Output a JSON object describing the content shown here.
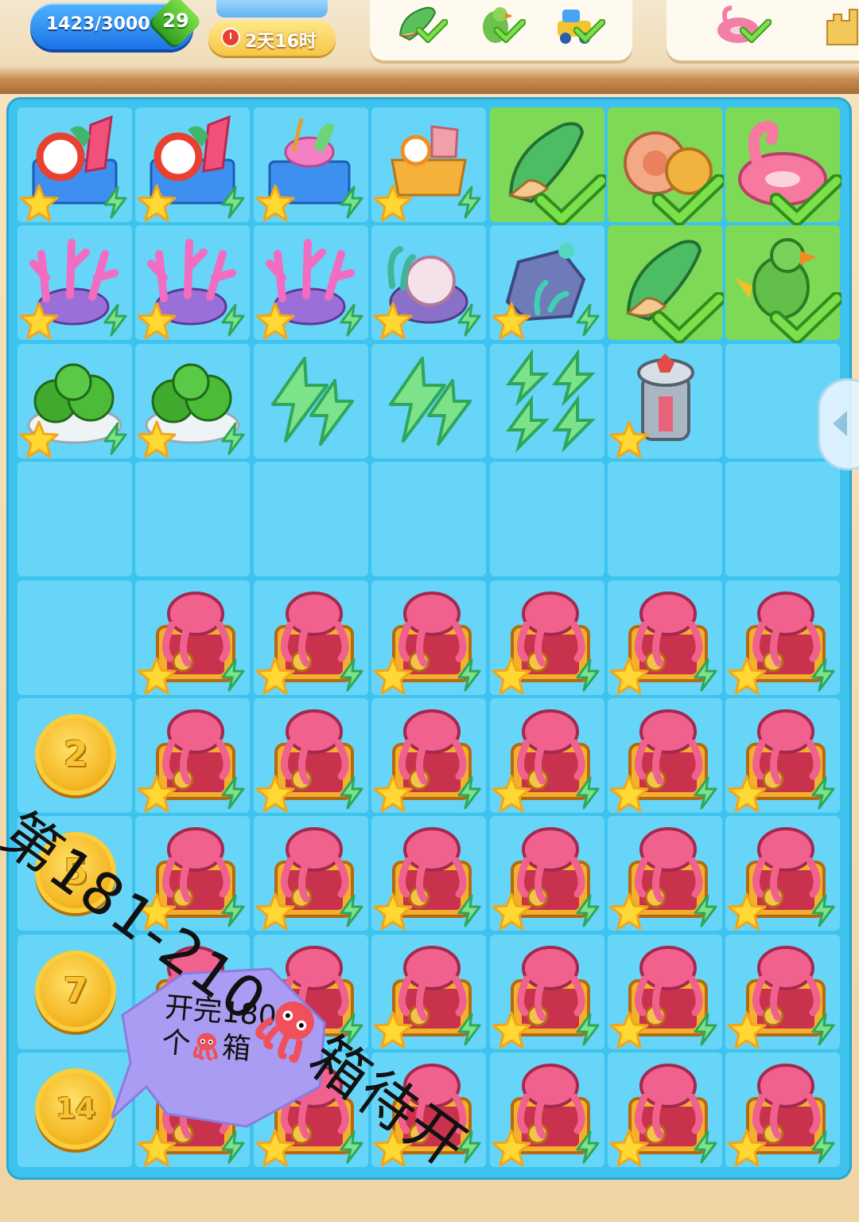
{
  "hud": {
    "xp_text": "1423/3000",
    "level": "29",
    "timer": "2天16时"
  },
  "orders": [
    {
      "items": [
        "green-conch-shell",
        "green-parrot",
        "sand-toy-truck"
      ],
      "completed": true
    },
    {
      "items": [
        "pink-flamingo-float",
        "sand-castle"
      ],
      "completed": true
    }
  ],
  "board": {
    "rows": [
      [
        "surf-cart-lvl3",
        "surf-cart-lvl3",
        "beach-basket-cart",
        "surf-supply-box",
        "green-conch-shell-check",
        "spiral-seashell-check",
        "pink-flamingo-float-check"
      ],
      [
        "pink-coral-reef",
        "pink-coral-reef",
        "pink-coral-reef",
        "sea-rock-shell",
        "grey-rock-seaweed",
        "green-conch-shell-check",
        "green-parrot-check"
      ],
      [
        "watermelon-plate",
        "watermelon-plate",
        "energy-bolt-2",
        "energy-bolt-2",
        "energy-bolt-4",
        "juicer-machine",
        "empty"
      ],
      [
        "empty",
        "empty",
        "empty",
        "empty",
        "empty",
        "empty",
        "empty"
      ],
      [
        "empty",
        "octopus-chest",
        "octopus-chest",
        "octopus-chest",
        "octopus-chest",
        "octopus-chest",
        "octopus-chest"
      ],
      [
        "coin",
        "octopus-chest",
        "octopus-chest",
        "octopus-chest",
        "octopus-chest",
        "octopus-chest",
        "octopus-chest"
      ],
      [
        "coin",
        "octopus-chest",
        "octopus-chest",
        "octopus-chest",
        "octopus-chest",
        "octopus-chest",
        "octopus-chest"
      ],
      [
        "coin",
        "octopus-chest",
        "octopus-chest",
        "octopus-chest",
        "octopus-chest",
        "octopus-chest",
        "octopus-chest"
      ],
      [
        "coin",
        "octopus-chest",
        "octopus-chest",
        "octopus-chest",
        "octopus-chest",
        "octopus-chest",
        "octopus-chest"
      ]
    ],
    "coins": [
      "2",
      "5",
      "7",
      "14"
    ]
  },
  "overlay": {
    "main_text_before": "第181-210",
    "main_text_after": "箱待开",
    "bubble_line1": "开完180",
    "bubble_line2_before": "个",
    "bubble_line2_after": "箱",
    "emoji": "octopus-emoji"
  },
  "colors": {
    "board_bg": "#3ec3ee",
    "cell_bg": "#66d5f7",
    "completed_cell_bg": "#7ed957",
    "check_green": "#5fd33b",
    "bubble_purple": "#a99cf2"
  }
}
